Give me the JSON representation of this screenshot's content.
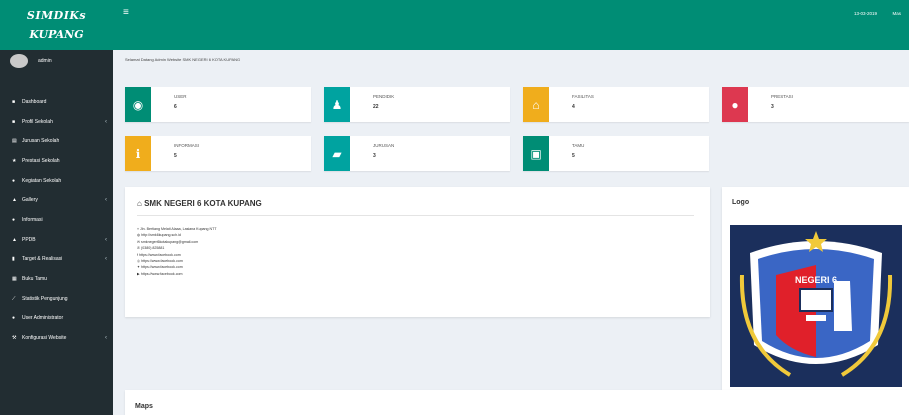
{
  "brand": {
    "line1": "SIMDIKs",
    "line2": "KUPANG"
  },
  "user": {
    "name": "admin"
  },
  "menu": [
    {
      "label": "Dashboard",
      "icon": "dashboard-icon",
      "glyph": "■",
      "has_arrow": false
    },
    {
      "label": "Profil Sekolah",
      "icon": "school-icon",
      "glyph": "■",
      "has_arrow": true
    },
    {
      "label": "Jurusan Sekolah",
      "icon": "list-icon",
      "glyph": "▤",
      "has_arrow": false
    },
    {
      "label": "Prestasi Sekolah",
      "icon": "trophy-icon",
      "glyph": "★",
      "has_arrow": false
    },
    {
      "label": "Kegiatan Sekolah",
      "icon": "calendar-icon",
      "glyph": "●",
      "has_arrow": false
    },
    {
      "label": "Gallery",
      "icon": "image-icon",
      "glyph": "▲",
      "has_arrow": true
    },
    {
      "label": "Informasi",
      "icon": "info-icon",
      "glyph": "●",
      "has_arrow": false
    },
    {
      "label": "PPDB",
      "icon": "users-icon",
      "glyph": "▲",
      "has_arrow": true
    },
    {
      "label": "Target & Realisasi",
      "icon": "chart-icon",
      "glyph": "▮",
      "has_arrow": true
    },
    {
      "label": "Buku Tamu",
      "icon": "book-icon",
      "glyph": "▦",
      "has_arrow": false
    },
    {
      "label": "Statistik Pengunjung",
      "icon": "line-chart-icon",
      "glyph": "⟋",
      "has_arrow": false
    },
    {
      "label": "User Administrator",
      "icon": "user-icon",
      "glyph": "●",
      "has_arrow": false
    },
    {
      "label": "Konfigurasi Website",
      "icon": "wrench-icon",
      "glyph": "⚒",
      "has_arrow": true
    }
  ],
  "header": {
    "menu_glyph": "≡",
    "date": "13-03-2019",
    "user_label": "Mas"
  },
  "welcome_text": "Selamat Datang Admin Website SMK NEGERI 6 KOTA KUPANG",
  "info_boxes": [
    {
      "label": "USER",
      "value": "6",
      "color": "#008d75",
      "icon": "user-circle-icon",
      "glyph": "◉"
    },
    {
      "label": "PENDIDIK",
      "value": "22",
      "color": "#00a3a0",
      "icon": "person-icon",
      "glyph": "♟"
    },
    {
      "label": "FASILITAS",
      "value": "4",
      "color": "#f0ad1c",
      "icon": "home-icon",
      "glyph": "⌂"
    },
    {
      "label": "PRESTASI",
      "value": "3",
      "color": "#dd3850",
      "icon": "trophy-icon",
      "glyph": "●"
    },
    {
      "label": "INFORMASI",
      "value": "5",
      "color": "#f0ad1c",
      "icon": "info-icon",
      "glyph": "ℹ"
    },
    {
      "label": "JURUSAN",
      "value": "3",
      "color": "#00a3a0",
      "icon": "graduation-cap-icon",
      "glyph": "▰"
    },
    {
      "label": "TAMU",
      "value": "5",
      "color": "#008d75",
      "icon": "contact-card-icon",
      "glyph": "▣"
    }
  ],
  "profile": {
    "title": "SMK NEGERI 6 KOTA KUPANG",
    "title_icon": "home-icon",
    "lines": [
      "Jln. Bertiang Melati Alaaa, Lasiana Kupang NTT",
      "http://smk6kupang.sch.id",
      "smknegeri6kotakupang@gmail.com",
      "(0380) 825881",
      "https://www.facebook.com",
      "https://www.facebook.com",
      "https://www.facebook.com",
      "https://www.facebook.com"
    ]
  },
  "logo_panel": {
    "title": "Logo",
    "emblem_text": "NEGERI 6",
    "emblem_arc": "SEKOLAH MENENGAH KEJURUAN",
    "colors": {
      "navy": "#1b2f5c",
      "blue": "#3a66c5",
      "red": "#e0202a",
      "gold": "#f0c93a"
    }
  },
  "maps": {
    "title": "Maps"
  }
}
